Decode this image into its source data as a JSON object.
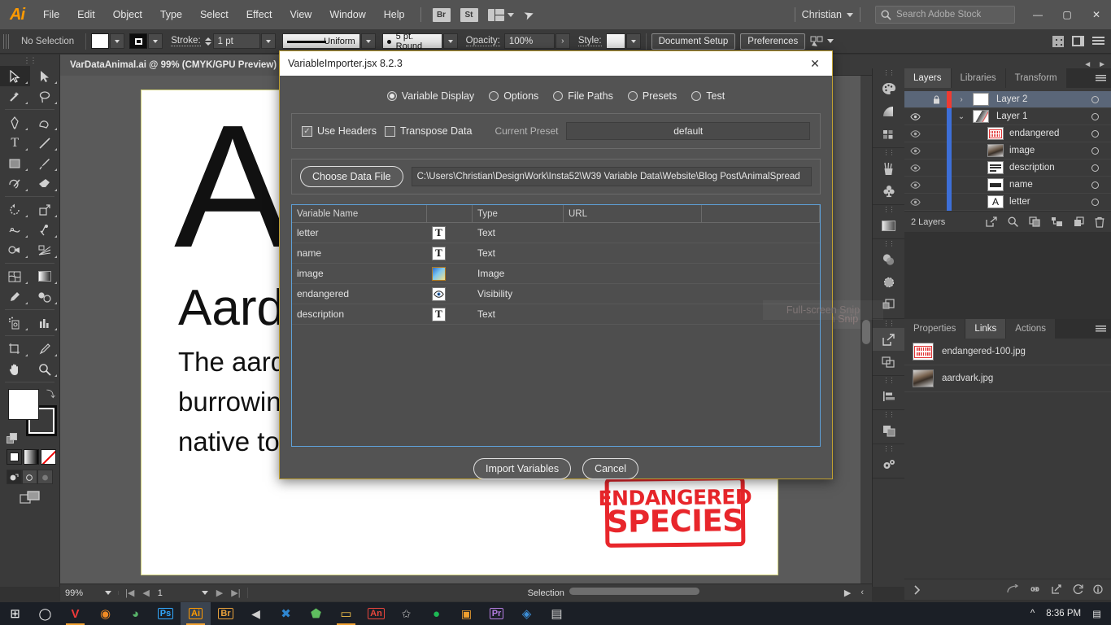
{
  "app": {
    "logo": "Ai",
    "menus": [
      "File",
      "Edit",
      "Object",
      "Type",
      "Select",
      "Effect",
      "View",
      "Window",
      "Help"
    ],
    "quick_buttons": [
      "Br",
      "St"
    ],
    "user": "Christian",
    "stock_search_placeholder": "Search Adobe Stock",
    "window_buttons": {
      "minimize": "—",
      "maximize": "▢",
      "close": "✕"
    }
  },
  "control_bar": {
    "selection_status": "No Selection",
    "stroke_label": "Stroke:",
    "stroke_weight": "1 pt",
    "profile": "Uniform",
    "brush": "5 pt. Round",
    "opacity_label": "Opacity:",
    "opacity_value": "100%",
    "style_label": "Style:",
    "document_setup": "Document Setup",
    "preferences": "Preferences"
  },
  "document": {
    "tab_title": "VarDataAnimal.ai @ 99% (CMYK/GPU Preview)",
    "artboard": {
      "letter": "A",
      "name": "Aard",
      "description_lines": [
        "The aard",
        "burrowin",
        "native to"
      ],
      "stamp_line1": "ENDANGERED",
      "stamp_line2": "SPECIES"
    },
    "ghost_overlay": "Full-screen Snip"
  },
  "status_bar": {
    "zoom": "99%",
    "page": "1",
    "tool": "Selection"
  },
  "panels": {
    "group1_tabs": [
      {
        "label": "Layers",
        "active": true
      },
      {
        "label": "Libraries",
        "active": false
      },
      {
        "label": "Transform",
        "active": false
      }
    ],
    "layers": [
      {
        "name": "Layer 2",
        "selected": true,
        "visible": false,
        "locked": true,
        "expandable": true,
        "expanded": false,
        "color": "#ee3b33",
        "indent": 0,
        "thumb": "blank"
      },
      {
        "name": "Layer 1",
        "selected": false,
        "visible": true,
        "locked": false,
        "expandable": true,
        "expanded": true,
        "color": "#3d6fd8",
        "indent": 0,
        "thumb": "art"
      },
      {
        "name": "endangered",
        "selected": false,
        "visible": true,
        "locked": false,
        "expandable": false,
        "expanded": false,
        "color": "#3d6fd8",
        "indent": 1,
        "thumb": "stamp"
      },
      {
        "name": "image",
        "selected": false,
        "visible": true,
        "locked": false,
        "expandable": false,
        "expanded": false,
        "color": "#3d6fd8",
        "indent": 1,
        "thumb": "photo"
      },
      {
        "name": "description",
        "selected": false,
        "visible": true,
        "locked": false,
        "expandable": false,
        "expanded": false,
        "color": "#3d6fd8",
        "indent": 1,
        "thumb": "lines"
      },
      {
        "name": "name",
        "selected": false,
        "visible": true,
        "locked": false,
        "expandable": false,
        "expanded": false,
        "color": "#3d6fd8",
        "indent": 1,
        "thumb": "lines"
      },
      {
        "name": "letter",
        "selected": false,
        "visible": true,
        "locked": false,
        "expandable": false,
        "expanded": false,
        "color": "#3d6fd8",
        "indent": 1,
        "thumb": "letterA"
      }
    ],
    "layers_footer_count": "2 Layers",
    "group2_tabs": [
      {
        "label": "Properties",
        "active": false
      },
      {
        "label": "Links",
        "active": true
      },
      {
        "label": "Actions",
        "active": false
      }
    ],
    "links": [
      {
        "name": "endangered-100.jpg",
        "thumb": "stamp"
      },
      {
        "name": "aardvark.jpg",
        "thumb": "photo"
      }
    ]
  },
  "dialog": {
    "title": "VariableImporter.jsx 8.2.3",
    "close_label": "✕",
    "modes": [
      {
        "label": "Variable Display",
        "selected": true
      },
      {
        "label": "Options",
        "selected": false
      },
      {
        "label": "File Paths",
        "selected": false
      },
      {
        "label": "Presets",
        "selected": false
      },
      {
        "label": "Test",
        "selected": false
      }
    ],
    "use_headers": {
      "label": "Use Headers",
      "checked": true
    },
    "transpose_data": {
      "label": "Transpose Data",
      "checked": false
    },
    "current_preset_label": "Current Preset",
    "current_preset_value": "default",
    "choose_data_file_label": "Choose Data File",
    "data_file_path": "C:\\Users\\Christian\\DesignWork\\Insta52\\W39 Variable Data\\Website\\Blog Post\\AnimalSpread",
    "table": {
      "columns": [
        "Variable Name",
        "",
        "Type",
        "URL",
        ""
      ],
      "rows": [
        {
          "variable_name": "letter",
          "icon": "text-icon",
          "type": "Text",
          "url": ""
        },
        {
          "variable_name": "name",
          "icon": "text-icon",
          "type": "Text",
          "url": ""
        },
        {
          "variable_name": "image",
          "icon": "image-icon",
          "type": "Image",
          "url": ""
        },
        {
          "variable_name": "endangered",
          "icon": "visibility-icon",
          "type": "Visibility",
          "url": ""
        },
        {
          "variable_name": "description",
          "icon": "text-icon",
          "type": "Text",
          "url": ""
        }
      ]
    },
    "import_button": "Import Variables",
    "cancel_button": "Cancel"
  },
  "taskbar": {
    "clock": "8:36 PM",
    "apps": [
      {
        "name": "start",
        "glyph": "⊞",
        "color": "#ffffff",
        "active": false,
        "running": false
      },
      {
        "name": "cortana",
        "glyph": "◯",
        "color": "#ffffff",
        "active": false,
        "running": false
      },
      {
        "name": "vivaldi",
        "glyph": "V",
        "color": "#ef3939",
        "active": false,
        "running": true
      },
      {
        "name": "firefox",
        "glyph": "◉",
        "color": "#f08a24",
        "active": false,
        "running": false
      },
      {
        "name": "browser",
        "glyph": "◕",
        "color": "#58b46a",
        "active": false,
        "running": false
      },
      {
        "name": "photoshop",
        "glyph": "Ps",
        "color": "#31a8ff",
        "active": false,
        "running": false
      },
      {
        "name": "illustrator",
        "glyph": "Ai",
        "color": "#ff9a00",
        "active": true,
        "running": true
      },
      {
        "name": "bridge",
        "glyph": "Br",
        "color": "#e9a13b",
        "active": false,
        "running": false
      },
      {
        "name": "affinity",
        "glyph": "◀",
        "color": "#cfcfcf",
        "active": false,
        "running": false
      },
      {
        "name": "vscode",
        "glyph": "✖",
        "color": "#2f86d0",
        "active": false,
        "running": false
      },
      {
        "name": "home",
        "glyph": "⬟",
        "color": "#5fbf5f",
        "active": false,
        "running": false
      },
      {
        "name": "explorer",
        "glyph": "▭",
        "color": "#f2c14a",
        "active": false,
        "running": true
      },
      {
        "name": "animate",
        "glyph": "An",
        "color": "#e8453c",
        "active": false,
        "running": false
      },
      {
        "name": "star",
        "glyph": "✩",
        "color": "#b8b8b8",
        "active": false,
        "running": false
      },
      {
        "name": "spotify",
        "glyph": "♫",
        "color": "#1db954",
        "active": false,
        "running": false
      },
      {
        "name": "instagram",
        "glyph": "◙",
        "color": "#f0a030",
        "active": false,
        "running": false
      },
      {
        "name": "premiere",
        "glyph": "Pr",
        "color": "#b47de0",
        "active": false,
        "running": false
      },
      {
        "name": "dropbox",
        "glyph": "◈",
        "color": "#3d8fd8",
        "active": false,
        "running": false
      },
      {
        "name": "notepad",
        "glyph": "▤",
        "color": "#cfcfcf",
        "active": false,
        "running": false
      }
    ]
  }
}
